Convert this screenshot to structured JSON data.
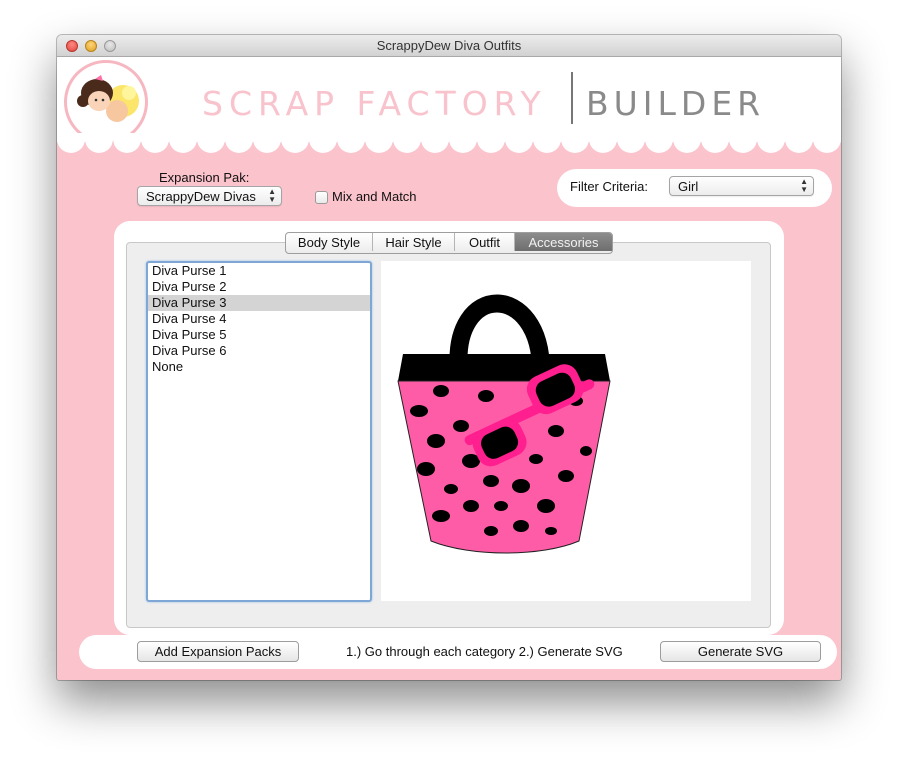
{
  "window": {
    "title": "ScrappyDew Diva Outfits"
  },
  "header": {
    "brand_left": "SCRAP FACTORY",
    "brand_right": "BUILDER"
  },
  "controls": {
    "expansion_label": "Expansion Pak:",
    "expansion_value": "ScrappyDew Divas",
    "mix_match_label": "Mix and Match",
    "mix_match_checked": false,
    "filter_label": "Filter Criteria:",
    "filter_value": "Girl"
  },
  "tabs": [
    {
      "label": "Body Style",
      "active": false
    },
    {
      "label": "Hair Style",
      "active": false
    },
    {
      "label": "Outfit",
      "active": false
    },
    {
      "label": "Accessories",
      "active": true
    }
  ],
  "list": {
    "items": [
      "Diva Purse 1",
      "Diva Purse 2",
      "Diva Purse 3",
      "Diva Purse 4",
      "Diva Purse 5",
      "Diva Purse 6",
      "None"
    ],
    "selected_index": 2
  },
  "footer": {
    "add_button": "Add Expansion Packs",
    "instructions": "1.) Go through each category 2.)  Generate SVG",
    "generate_button": "Generate SVG"
  },
  "colors": {
    "background_pink": "#fbc3cb",
    "purse_pink": "#ff5ca8",
    "glasses_pink": "#ff1f8f",
    "selection_gray": "#d4d4d4"
  }
}
